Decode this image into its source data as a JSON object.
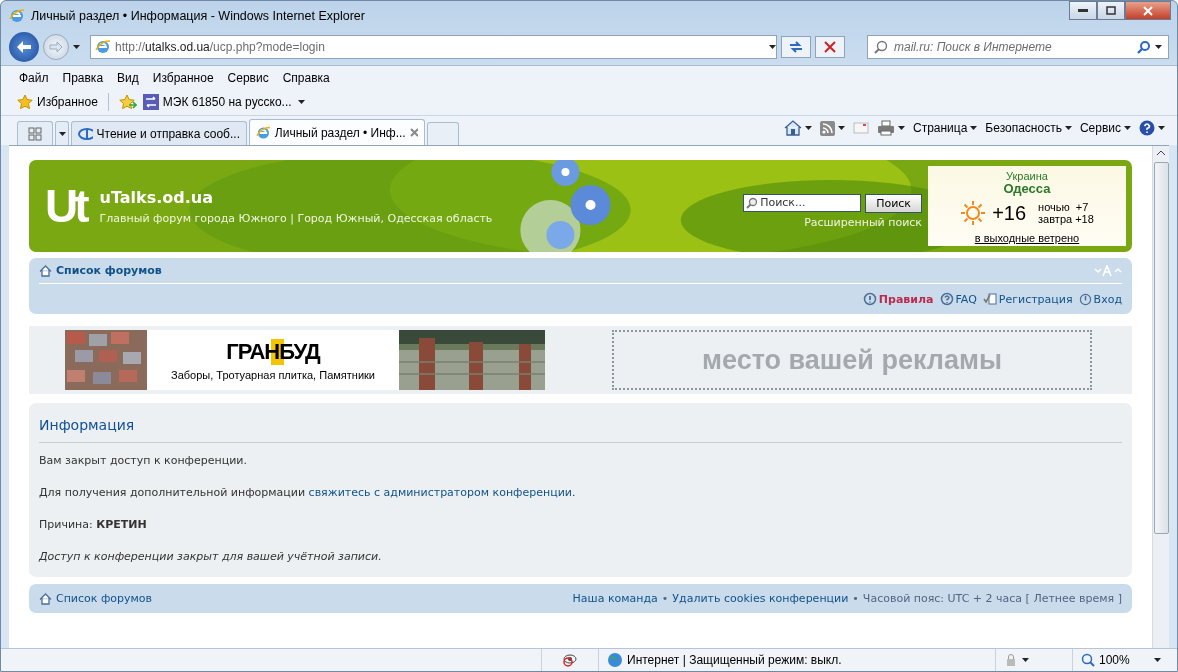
{
  "window": {
    "title": "Личный раздел • Информация - Windows Internet Explorer"
  },
  "address": {
    "url": "http://**utalks.od.ua**/ucp.php?mode=login",
    "search_placeholder": "mail.ru: Поиск в Интернете"
  },
  "menu": [
    "Файл",
    "Правка",
    "Вид",
    "Избранное",
    "Сервис",
    "Справка"
  ],
  "favorites": {
    "label": "Избранное",
    "link": "МЭК 61850 на русско..."
  },
  "tabs": [
    {
      "label": "Чтение и отправка сооб...",
      "selected": false
    },
    {
      "label": "Личный раздел • Инф...",
      "selected": true
    }
  ],
  "command_bar": [
    "Страница",
    "Безопасность",
    "Сервис"
  ],
  "site": {
    "logo": "Ut",
    "name": "uTalks.od.ua",
    "tagline": "Главный форум города Южного | Город Южный, Одесская область"
  },
  "search": {
    "placeholder": "Поиск...",
    "button": "Поиск",
    "advanced": "Расширенный поиск"
  },
  "weather": {
    "country": "Украина",
    "city": "Одесса",
    "temp": "+16",
    "night": "ночью  +7",
    "tomorrow": "завтра +18",
    "note": "в выходные ветрено"
  },
  "nav": {
    "home": "Список форумов",
    "links": [
      {
        "label": "Правила",
        "kind": "rules"
      },
      {
        "label": "FAQ",
        "kind": "faq"
      },
      {
        "label": "Регистрация",
        "kind": "register"
      },
      {
        "label": "Вход",
        "kind": "login"
      }
    ]
  },
  "ads": {
    "brand": "ГРАНБУД",
    "slogan": "Заборы, Тротуарная плитка, Памятники",
    "placeholder": "место вашей рекламы"
  },
  "info": {
    "title": "Информация",
    "message": "Вам закрыт доступ к конференции.",
    "contact_before": "Для получения дополнительной информации ",
    "contact_link": "свяжитесь с администратором конференции",
    "contact_after": ".",
    "reason": "Причина: **КРЕТИН**",
    "note": "Доступ к конференции закрыт для вашей учётной записи."
  },
  "footer": {
    "home": "Список форумов",
    "links": [
      "Наша команда",
      "Удалить cookies конференции"
    ],
    "separator": "•",
    "timezone": "Часовой пояс: UTC + 2 часа [ Летнее время ]"
  },
  "status": {
    "zone": "Интернет | Защищенный режим: выкл.",
    "zoom": "100%"
  }
}
